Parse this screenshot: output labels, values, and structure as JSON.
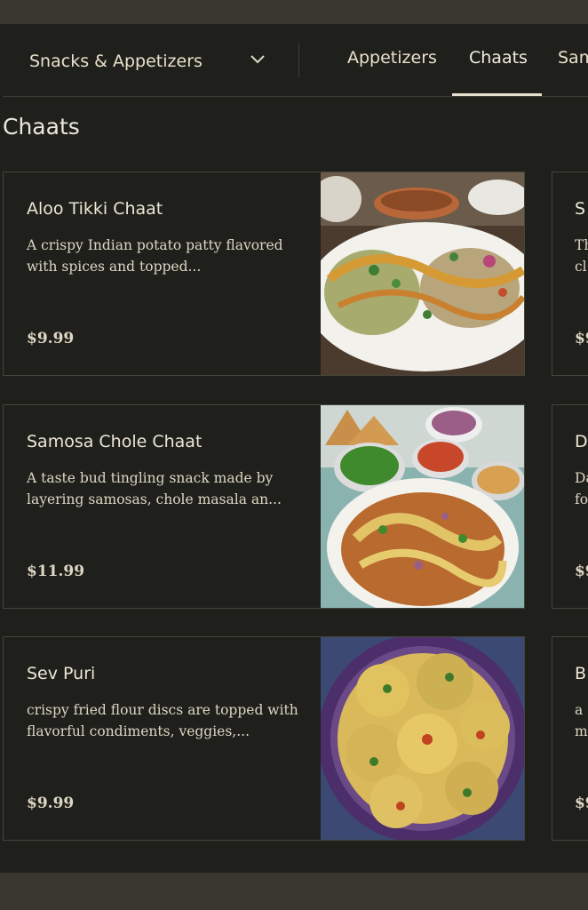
{
  "nav": {
    "category_select": "Snacks & Appetizers",
    "tabs": [
      {
        "label": "Appetizers"
      },
      {
        "label": "Chaats"
      },
      {
        "label": "Sam"
      }
    ],
    "active_tab": "Chaats"
  },
  "section": {
    "title": "Chaats"
  },
  "items": [
    {
      "name": "Aloo Tikki Chaat",
      "description": "A crispy Indian potato patty flavored with spices and topped...",
      "price": "$9.99",
      "image": "aloo-tikki-chaat-photo"
    },
    {
      "name": "Samosa Chole Chaat",
      "description": "A taste bud tingling snack made by layering samosas, chole masala an...",
      "price": "$11.99",
      "image": "samosa-chole-chaat-photo"
    },
    {
      "name": "Sev Puri",
      "description": "crispy fried flour discs are topped with flavorful condiments, veggies,...",
      "price": "$9.99",
      "image": "sev-puri-photo"
    }
  ],
  "peek_items": [
    {
      "name": "S",
      "desc1": "Th",
      "desc2": "cl",
      "price": "$9"
    },
    {
      "name": "D",
      "desc1": "Da",
      "desc2": "fo",
      "price": "$9"
    },
    {
      "name": "B",
      "desc1": "a",
      "desc2": "m",
      "price": "$9"
    }
  ],
  "colors": {
    "background": "#1f201b",
    "bar": "#39372e",
    "border": "#45443b",
    "text": "#e9e4d6",
    "active_underline": "#e6dfcf"
  },
  "icons": [
    "chevron-down-icon"
  ]
}
